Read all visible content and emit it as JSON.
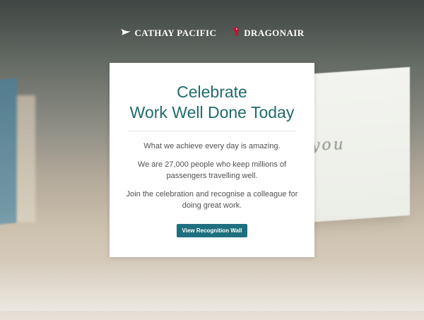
{
  "header": {
    "brand_primary": "CATHAY PACIFIC",
    "brand_secondary": "DRAGONAIR"
  },
  "panel": {
    "title_line1": "Celebrate",
    "title_line2": "Work Well Done Today",
    "paragraph1": "What we achieve every day is amazing.",
    "paragraph2": "We are 27,000 people who keep millions of passengers travelling well.",
    "paragraph3": "Join the celebration and recognise a colleague for doing great work.",
    "button_label": "View Recognition Wall"
  },
  "background": {
    "card_text": "you"
  },
  "colors": {
    "accent": "#1f6b6b",
    "button": "#1e6f7f",
    "dragonair_red": "#c8102e"
  },
  "icons": {
    "brand_primary_icon": "cathay-brushwing-icon",
    "brand_secondary_icon": "dragon-icon"
  }
}
